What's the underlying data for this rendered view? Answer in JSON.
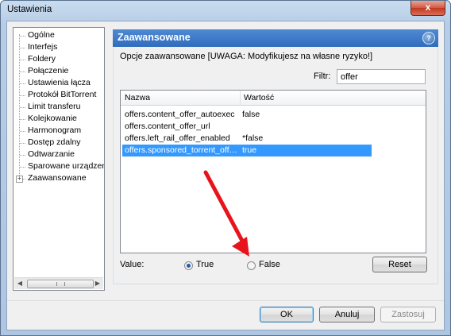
{
  "window": {
    "title": "Ustawienia",
    "close_glyph": "x"
  },
  "sidebar": {
    "items": [
      {
        "label": "Ogólne"
      },
      {
        "label": "Interfejs"
      },
      {
        "label": "Foldery"
      },
      {
        "label": "Połączenie"
      },
      {
        "label": "Ustawienia łącza"
      },
      {
        "label": "Protokół BitTorrent"
      },
      {
        "label": "Limit transferu"
      },
      {
        "label": "Kolejkowanie"
      },
      {
        "label": "Harmonogram"
      },
      {
        "label": "Dostęp zdalny"
      },
      {
        "label": "Odtwarzanie"
      },
      {
        "label": "Sparowane urządzen"
      },
      {
        "label": "Zaawansowane",
        "expander": "+"
      }
    ],
    "scroll_left": "◀",
    "scroll_right": "▶"
  },
  "panel": {
    "title": "Zaawansowane",
    "help_glyph": "?",
    "description": "Opcje zaawansowane [UWAGA: Modyfikujesz na własne ryzyko!]",
    "filter_label": "Filtr:",
    "filter_value": "offer"
  },
  "table": {
    "headers": {
      "name": "Nazwa",
      "value": "Wartość"
    },
    "rows": [
      {
        "name": "offers.content_offer_autoexec",
        "value": "false",
        "selected": false
      },
      {
        "name": "offers.content_offer_url",
        "value": "",
        "selected": false
      },
      {
        "name": "offers.left_rail_offer_enabled",
        "value": "*false",
        "selected": false
      },
      {
        "name": "offers.sponsored_torrent_offer_enabled",
        "value": "true",
        "selected": true
      }
    ]
  },
  "value_editor": {
    "label": "Value:",
    "options": [
      {
        "label": "True",
        "checked": true
      },
      {
        "label": "False",
        "checked": false
      }
    ],
    "reset_label": "Reset"
  },
  "footer": {
    "ok_label": "OK",
    "cancel_label": "Anuluj",
    "apply_label": "Zastosuj"
  },
  "colors": {
    "selection": "#3399ff",
    "header_bg": "#3a76c4",
    "arrow": "#e8141b"
  }
}
